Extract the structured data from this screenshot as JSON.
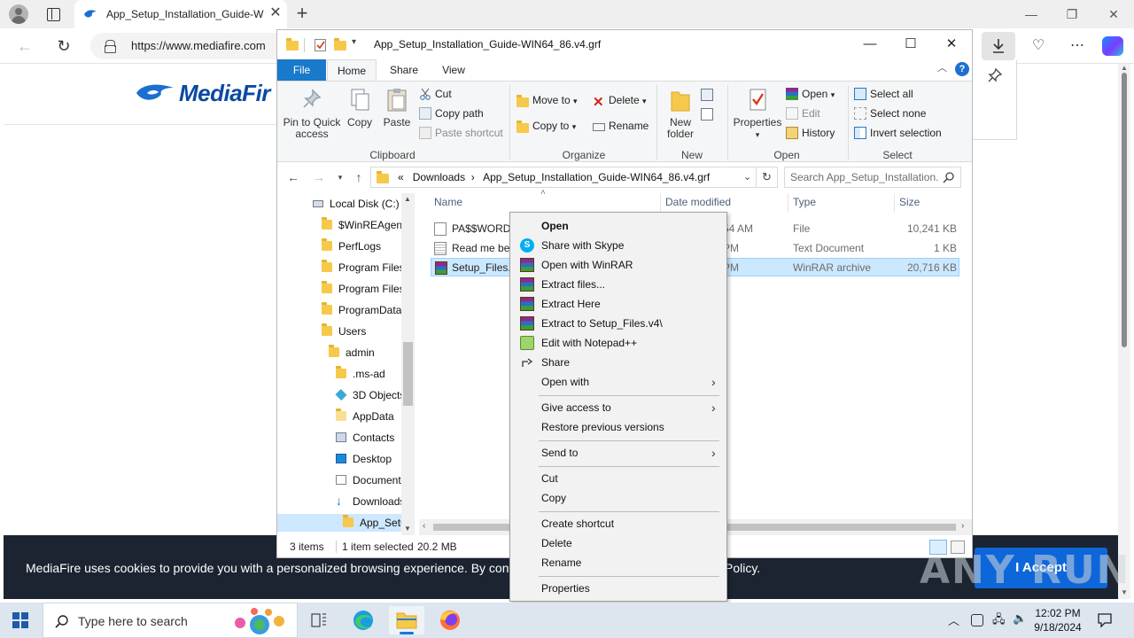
{
  "browser": {
    "tab_title": "App_Setup_Installation_Guide-W",
    "url": "https://www.mediafire.com",
    "minimize": "—",
    "maximize": "❐",
    "close": "✕"
  },
  "page": {
    "logo_text": "MediaFir",
    "cookie_message": "MediaFire uses cookies to provide you with a personalized browsing experience. By continuing",
    "cookie_message_tail": "Policy.",
    "accept_label": "I Accept",
    "watermark": "ANY RUN"
  },
  "explorer": {
    "title": "App_Setup_Installation_Guide-WIN64_86.v4.grf",
    "tabs": [
      "File",
      "Home",
      "Share",
      "View"
    ],
    "ribbon": {
      "clipboard": {
        "pin": "Pin to Quick access",
        "copy": "Copy",
        "paste": "Paste",
        "cut": "Cut",
        "copy_path": "Copy path",
        "paste_shortcut": "Paste shortcut",
        "label": "Clipboard"
      },
      "organize": {
        "move_to": "Move to",
        "copy_to": "Copy to",
        "delete": "Delete",
        "rename": "Rename",
        "label": "Organize"
      },
      "new": {
        "new_folder": "New folder",
        "label": "New"
      },
      "open": {
        "properties": "Properties",
        "open": "Open",
        "edit": "Edit",
        "history": "History",
        "label": "Open"
      },
      "select": {
        "select_all": "Select all",
        "select_none": "Select none",
        "invert": "Invert selection",
        "label": "Select"
      }
    },
    "address": {
      "prefix": "«",
      "segments": [
        "Downloads",
        "App_Setup_Installation_Guide-WIN64_86.v4.grf"
      ],
      "search_placeholder": "Search App_Setup_Installation..."
    },
    "tree": [
      {
        "label": "Local Disk (C:)",
        "icon": "drive-icon"
      },
      {
        "label": "$WinREAgent",
        "icon": "folder-icon"
      },
      {
        "label": "PerfLogs",
        "icon": "folder-icon"
      },
      {
        "label": "Program Files",
        "icon": "folder-icon"
      },
      {
        "label": "Program Files",
        "icon": "folder-icon"
      },
      {
        "label": "ProgramData",
        "icon": "folder-icon"
      },
      {
        "label": "Users",
        "icon": "folder-icon"
      },
      {
        "label": "admin",
        "icon": "folder-icon"
      },
      {
        "label": ".ms-ad",
        "icon": "folder-icon"
      },
      {
        "label": "3D Objects",
        "icon": "cube-icon"
      },
      {
        "label": "AppData",
        "icon": "folder-icon"
      },
      {
        "label": "Contacts",
        "icon": "contacts-icon"
      },
      {
        "label": "Desktop",
        "icon": "desktop-icon"
      },
      {
        "label": "Documents",
        "icon": "documents-icon"
      },
      {
        "label": "Downloads",
        "icon": "downloads-icon"
      },
      {
        "label": "App_Setu",
        "icon": "folder-icon"
      }
    ],
    "columns": {
      "name": "Name",
      "date": "Date modified",
      "type": "Type",
      "size": "Size"
    },
    "files": [
      {
        "name": "PA$$WORD",
        "date": "54 AM",
        "type": "File",
        "size": "10,241 KB",
        "icon": "file-icon"
      },
      {
        "name": "Read me bef",
        "date": "PM",
        "type": "Text Document",
        "size": "1 KB",
        "icon": "text-file-icon"
      },
      {
        "name": "Setup_Files.v",
        "date": "PM",
        "type": "WinRAR archive",
        "size": "20,716 KB",
        "icon": "winrar-icon"
      }
    ],
    "status": {
      "items": "3 items",
      "selected": "1 item selected",
      "size": "20.2 MB"
    }
  },
  "context_menu": [
    {
      "label": "Open",
      "bold": true
    },
    {
      "label": "Share with Skype",
      "icon": "skype-icon"
    },
    {
      "label": "Open with WinRAR",
      "icon": "winrar-icon"
    },
    {
      "label": "Extract files...",
      "icon": "winrar-icon"
    },
    {
      "label": "Extract Here",
      "icon": "winrar-icon"
    },
    {
      "label": "Extract to Setup_Files.v4\\",
      "icon": "winrar-icon"
    },
    {
      "label": "Edit with Notepad++",
      "icon": "notepadpp-icon"
    },
    {
      "label": "Share",
      "icon": "share-icon"
    },
    {
      "label": "Open with",
      "submenu": true
    },
    {
      "label": "Give access to",
      "submenu": true
    },
    {
      "label": "Restore previous versions"
    },
    {
      "label": "Send to",
      "submenu": true
    },
    {
      "label": "Cut"
    },
    {
      "label": "Copy"
    },
    {
      "label": "Create shortcut"
    },
    {
      "label": "Delete"
    },
    {
      "label": "Rename"
    },
    {
      "label": "Properties"
    }
  ],
  "taskbar": {
    "search_placeholder": "Type here to search",
    "time": "12:02 PM",
    "date": "9/18/2024"
  },
  "colors": {
    "accent": "#1979ca",
    "selection": "#cce8ff",
    "cookie_bg": "#1c2431",
    "accept_bg": "#0e67d9",
    "mediafire_blue": "#0b49a1"
  }
}
